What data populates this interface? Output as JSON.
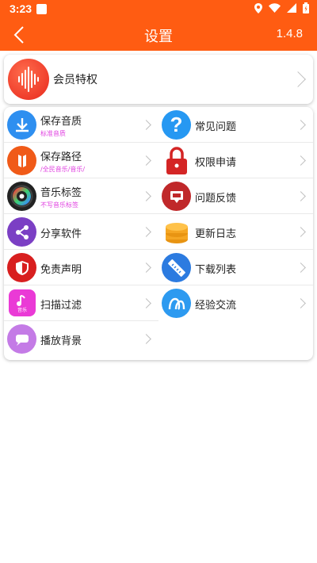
{
  "status_bar": {
    "time": "3:23"
  },
  "app_bar": {
    "title": "设置",
    "version": "1.4.8"
  },
  "vip": {
    "label": "会员特权"
  },
  "menu": {
    "items": [
      {
        "label": "保存音质",
        "sub": "标准音质",
        "icon": "download-icon",
        "color": "#2e8ff0"
      },
      {
        "label": "常见问题",
        "sub": "",
        "icon": "question-icon",
        "color": "#2698f2"
      },
      {
        "label": "保存路径",
        "sub": "/全民音乐/音乐/",
        "icon": "folder-path-icon",
        "color": "#f05a18"
      },
      {
        "label": "权限申请",
        "sub": "",
        "icon": "lock-icon",
        "color": "#d42525"
      },
      {
        "label": "音乐标签",
        "sub": "不写音乐标签",
        "icon": "vinyl-icon",
        "color": "#222222"
      },
      {
        "label": "问题反馈",
        "sub": "",
        "icon": "feedback-icon",
        "color": "#c0282a"
      },
      {
        "label": "分享软件",
        "sub": "",
        "icon": "share-icon",
        "color": "#7b3fc4"
      },
      {
        "label": "更新日志",
        "sub": "",
        "icon": "coins-icon",
        "color": "#f5a623"
      },
      {
        "label": "免责声明",
        "sub": "",
        "icon": "shield-icon",
        "color": "#d81f1f"
      },
      {
        "label": "下载列表",
        "sub": "",
        "icon": "ruler-icon",
        "color": "#2c7be0"
      },
      {
        "label": "扫描过滤",
        "sub": "",
        "icon": "music-note-icon",
        "color": "#ea3ad6",
        "icon_text": "音乐"
      },
      {
        "label": "经验交流",
        "sub": "",
        "icon": "qq-icon",
        "color": "#2d9af0"
      },
      {
        "label": "播放背景",
        "sub": "",
        "icon": "chat-bubble-icon",
        "color": "#c47be6"
      }
    ]
  }
}
